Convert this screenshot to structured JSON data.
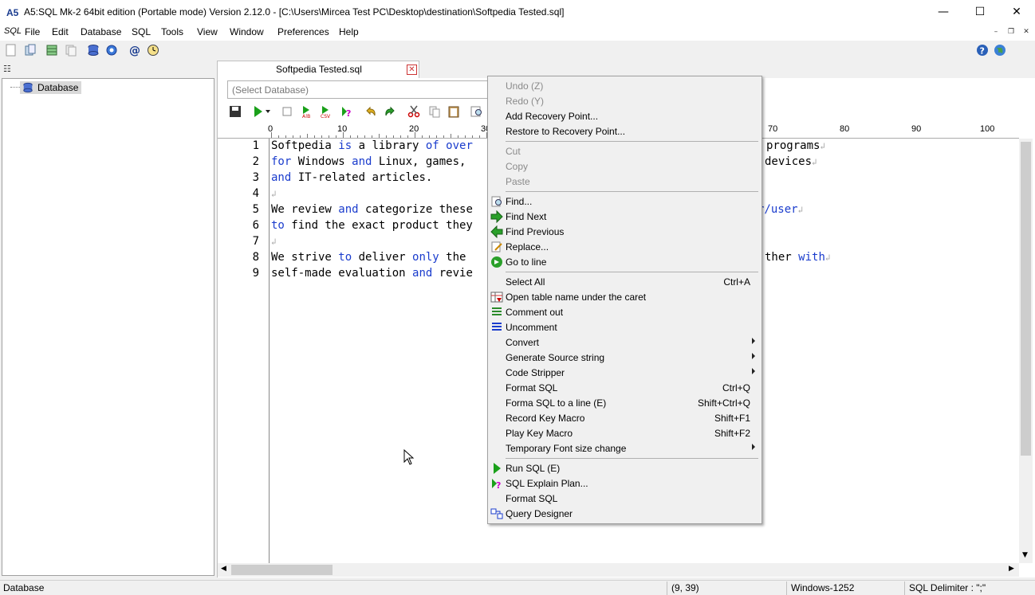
{
  "window": {
    "title": "A5:SQL Mk-2 64bit edition (Portable mode) Version 2.12.0 - [C:\\Users\\Mircea Test PC\\Desktop\\destination\\Softpedia Tested.sql]",
    "app_icon_text": "A5"
  },
  "menubar": {
    "logo": "SQL",
    "items": [
      "File",
      "Edit",
      "Database",
      "SQL",
      "Tools",
      "View",
      "Window",
      "Preferences",
      "Help"
    ]
  },
  "tree": {
    "root_label": "Database"
  },
  "document_tab": {
    "label": "Softpedia Tested.sql"
  },
  "editor": {
    "select_database_placeholder": "(Select Database)",
    "ruler_numbers": [
      "0",
      "10",
      "20",
      "30",
      "70",
      "80",
      "90",
      "100"
    ],
    "line_numbers": [
      "1",
      "2",
      "3",
      "4",
      "5",
      "6",
      "7",
      "8",
      "9"
    ]
  },
  "code_lines": [
    [
      [
        "Softpedia ",
        ""
      ],
      [
        "is",
        "kw"
      ],
      [
        " a library ",
        ""
      ],
      [
        "of",
        "kw"
      ],
      [
        " ",
        ""
      ],
      [
        "over",
        "kw"
      ]
    ],
    [
      [
        "for",
        "kw"
      ],
      [
        " Windows ",
        ""
      ],
      [
        "and",
        "kw"
      ],
      [
        " Linux, games, ",
        ""
      ]
    ],
    [
      [
        "and",
        "kw"
      ],
      [
        " IT-related articles.",
        ""
      ]
    ],
    [],
    [
      [
        "We review ",
        ""
      ],
      [
        "and",
        "kw"
      ],
      [
        " categorize these",
        ""
      ]
    ],
    [
      [
        "to",
        "kw"
      ],
      [
        " find the exact product they",
        ""
      ]
    ],
    [],
    [
      [
        "We strive ",
        ""
      ],
      [
        "to",
        "kw"
      ],
      [
        " deliver ",
        ""
      ],
      [
        "only",
        "kw"
      ],
      [
        " the",
        ""
      ]
    ],
    [
      [
        "self-made evaluation ",
        ""
      ],
      [
        "and",
        "kw"
      ],
      [
        " revie",
        ""
      ]
    ]
  ],
  "code_right_fragments": [
    {
      "line": 1,
      "text": "programs",
      "cls": ""
    },
    {
      "line": 2,
      "text": "devices",
      "cls": ""
    },
    {
      "line": 5,
      "text": "r/user",
      "cls": "kw"
    },
    {
      "line": 8,
      "text": "ther ",
      "cls": "",
      "extra": "with",
      "extra_cls": "kw"
    }
  ],
  "context_menu": {
    "groups": [
      [
        {
          "label": "Undo (Z)",
          "disabled": true
        },
        {
          "label": "Redo (Y)",
          "disabled": true
        },
        {
          "label": "Add Recovery Point..."
        },
        {
          "label": "Restore to Recovery Point..."
        }
      ],
      [
        {
          "label": "Cut",
          "disabled": true
        },
        {
          "label": "Copy",
          "disabled": true
        },
        {
          "label": "Paste",
          "disabled": true
        }
      ],
      [
        {
          "label": "Find...",
          "icon": "find-icon"
        },
        {
          "label": "Find Next",
          "icon": "find-next-icon"
        },
        {
          "label": "Find Previous",
          "icon": "find-previous-icon"
        },
        {
          "label": "Replace...",
          "icon": "replace-icon"
        },
        {
          "label": "Go to line",
          "icon": "goto-line-icon"
        }
      ],
      [
        {
          "label": "Select All",
          "shortcut": "Ctrl+A"
        },
        {
          "label": "Open table name under the caret",
          "icon": "open-table-icon"
        },
        {
          "label": "Comment out",
          "icon": "comment-out-icon"
        },
        {
          "label": "Uncomment",
          "icon": "uncomment-icon"
        },
        {
          "label": "Convert",
          "submenu": true
        },
        {
          "label": "Generate Source string",
          "submenu": true
        },
        {
          "label": "Code Stripper",
          "submenu": true
        },
        {
          "label": "Format SQL",
          "shortcut": "Ctrl+Q"
        },
        {
          "label": "Forma SQL to a line (E)",
          "shortcut": "Shift+Ctrl+Q"
        },
        {
          "label": "Record Key Macro",
          "shortcut": "Shift+F1"
        },
        {
          "label": "Play Key Macro",
          "shortcut": "Shift+F2"
        },
        {
          "label": "Temporary Font size change",
          "submenu": true
        }
      ],
      [
        {
          "label": "Run SQL (E)",
          "icon": "run-sql-icon"
        },
        {
          "label": "SQL Explain Plan...",
          "icon": "explain-plan-icon"
        },
        {
          "label": "Format SQL"
        },
        {
          "label": "Query Designer",
          "icon": "query-designer-icon"
        }
      ]
    ]
  },
  "statusbar": {
    "left": "Database",
    "position": "(9, 39)",
    "encoding": "Windows-1252",
    "delimiter": "SQL Delimiter : \";\""
  },
  "colors": {
    "keyword": "#1a3ccd",
    "accent": "#1a3c8f"
  }
}
